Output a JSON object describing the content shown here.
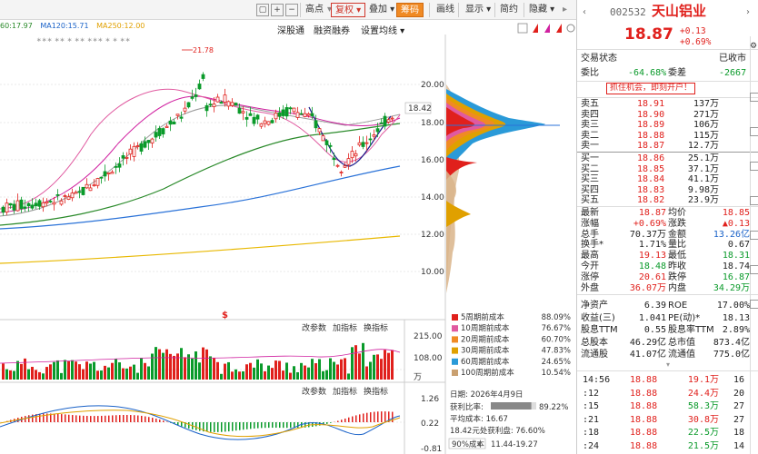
{
  "toolbar": {
    "items": [
      "高点",
      "复权",
      "叠加",
      "筹码",
      "画线",
      "显示",
      "简约",
      "隐藏"
    ],
    "active": "复权",
    "highlighted": "筹码"
  },
  "ma": {
    "ma60": "60:17.97",
    "ma120": "MA120:15.71",
    "ma250": "MA250:12.00",
    "ma60_color": "#2a8a2a",
    "ma120_color": "#1a62c8",
    "ma250_color": "#e0a000"
  },
  "submenu": {
    "items": [
      "深股通",
      "融资融券",
      "设置均线"
    ]
  },
  "chart": {
    "high_marker": "21.78",
    "price_ticks": [
      "20.00",
      "18.00",
      "16.00",
      "14.00",
      "12.00",
      "10.00"
    ],
    "current_price": "18.42",
    "vol_ticks": [
      "215.00",
      "108.00"
    ],
    "vol_unit": "万",
    "macd_ticks": [
      "1.26",
      "0.22",
      "-0.81"
    ],
    "panel_actions": [
      "改参数",
      "加指标",
      "换指标"
    ]
  },
  "chips": {
    "legend": [
      {
        "label": "5周期前成本",
        "value": "88.09%",
        "color": "#e0201c"
      },
      {
        "label": "10周期前成本",
        "value": "76.67%",
        "color": "#e05aa0"
      },
      {
        "label": "20周期前成本",
        "value": "60.70%",
        "color": "#f08a24"
      },
      {
        "label": "30周期前成本",
        "value": "47.83%",
        "color": "#e0a000"
      },
      {
        "label": "60周期前成本",
        "value": "24.65%",
        "color": "#2a9ad8"
      },
      {
        "label": "100周期前成本",
        "value": "10.54%",
        "color": "#c9a070"
      }
    ],
    "date": "日期: 2026年4月9日",
    "profit_ratio": "获利比率:",
    "profit_ratio_value": "89.22%",
    "avg_cost": "平均成本: 16.67",
    "profit_line": "18.42元处获利盘: 76.60%",
    "cost90_label": "90%成本",
    "cost90_value": "11.44-19.27"
  },
  "quote": {
    "code": "002532",
    "name": "天山铝业",
    "price": "18.87",
    "change": "+0.13",
    "change_pct": "+0.69%",
    "status_label": "交易状态",
    "status_value": "已收市",
    "weibi_label": "委比",
    "weibi_value": "-64.68%",
    "weicha_label": "委差",
    "weicha_value": "-2667",
    "promo": "抓住机会，即刻开户！",
    "sells": [
      {
        "label": "卖五",
        "price": "18.91",
        "vol": "137万"
      },
      {
        "label": "卖四",
        "price": "18.90",
        "vol": "271万"
      },
      {
        "label": "卖三",
        "price": "18.89",
        "vol": "106万"
      },
      {
        "label": "卖二",
        "price": "18.88",
        "vol": "115万"
      },
      {
        "label": "卖一",
        "price": "18.87",
        "vol": "12.7万"
      }
    ],
    "buys": [
      {
        "label": "买一",
        "price": "18.86",
        "vol": "25.1万"
      },
      {
        "label": "买二",
        "price": "18.85",
        "vol": "37.1万"
      },
      {
        "label": "买三",
        "price": "18.84",
        "vol": "41.1万"
      },
      {
        "label": "买四",
        "price": "18.83",
        "vol": "9.98万"
      },
      {
        "label": "买五",
        "price": "18.82",
        "vol": "23.9万"
      }
    ],
    "stats": [
      {
        "l1": "最新",
        "v1": "18.87",
        "c1": "red",
        "l2": "均价",
        "v2": "18.85",
        "c2": "red"
      },
      {
        "l1": "涨幅",
        "v1": "+0.69%",
        "c1": "red",
        "l2": "涨跌",
        "v2": "▲0.13",
        "c2": "red"
      },
      {
        "l1": "总手",
        "v1": "70.37万",
        "c1": "dark",
        "l2": "金额",
        "v2": "13.26亿",
        "c2": "blue"
      },
      {
        "l1": "换手*",
        "v1": "1.71%",
        "c1": "dark",
        "l2": "量比",
        "v2": "0.67",
        "c2": "dark"
      },
      {
        "l1": "最高",
        "v1": "19.13",
        "c1": "red",
        "l2": "最低",
        "v2": "18.31",
        "c2": "green"
      },
      {
        "l1": "今开",
        "v1": "18.48",
        "c1": "green",
        "l2": "昨收",
        "v2": "18.74",
        "c2": "dark"
      },
      {
        "l1": "涨停",
        "v1": "20.61",
        "c1": "red",
        "l2": "跌停",
        "v2": "16.87",
        "c2": "green"
      },
      {
        "l1": "外盘",
        "v1": "36.07万",
        "c1": "red",
        "l2": "内盘",
        "v2": "34.29万",
        "c2": "green"
      }
    ],
    "fund": [
      {
        "l1": "净资产",
        "v1": "6.39",
        "l2": "ROE",
        "v2": "17.00%"
      },
      {
        "l1": "收益(三)",
        "v1": "1.041",
        "l2": "PE(动)*",
        "v2": "18.13"
      },
      {
        "l1": "股息TTM",
        "v1": "0.55",
        "l2": "股息率TTM",
        "v2": "2.89%"
      },
      {
        "l1": "总股本",
        "v1": "46.29亿",
        "l2": "总市值",
        "v2": "873.4亿"
      },
      {
        "l1": "流通股",
        "v1": "41.07亿",
        "l2": "流通值",
        "v2": "775.0亿"
      }
    ],
    "ticks": [
      {
        "time": "14:56",
        "price": "18.88",
        "vol": "19.1万",
        "n": "16",
        "vc": "red"
      },
      {
        "time": ":12",
        "price": "18.88",
        "vol": "24.4万",
        "n": "20",
        "vc": "red"
      },
      {
        "time": ":15",
        "price": "18.88",
        "vol": "58.3万",
        "n": "27",
        "vc": "green"
      },
      {
        "time": ":21",
        "price": "18.88",
        "vol": "30.8万",
        "n": "27",
        "vc": "red"
      },
      {
        "time": ":18",
        "price": "18.88",
        "vol": "22.5万",
        "n": "18",
        "vc": "green"
      },
      {
        "time": ":24",
        "price": "18.88",
        "vol": "21.5万",
        "n": "14",
        "vc": "green"
      }
    ]
  }
}
